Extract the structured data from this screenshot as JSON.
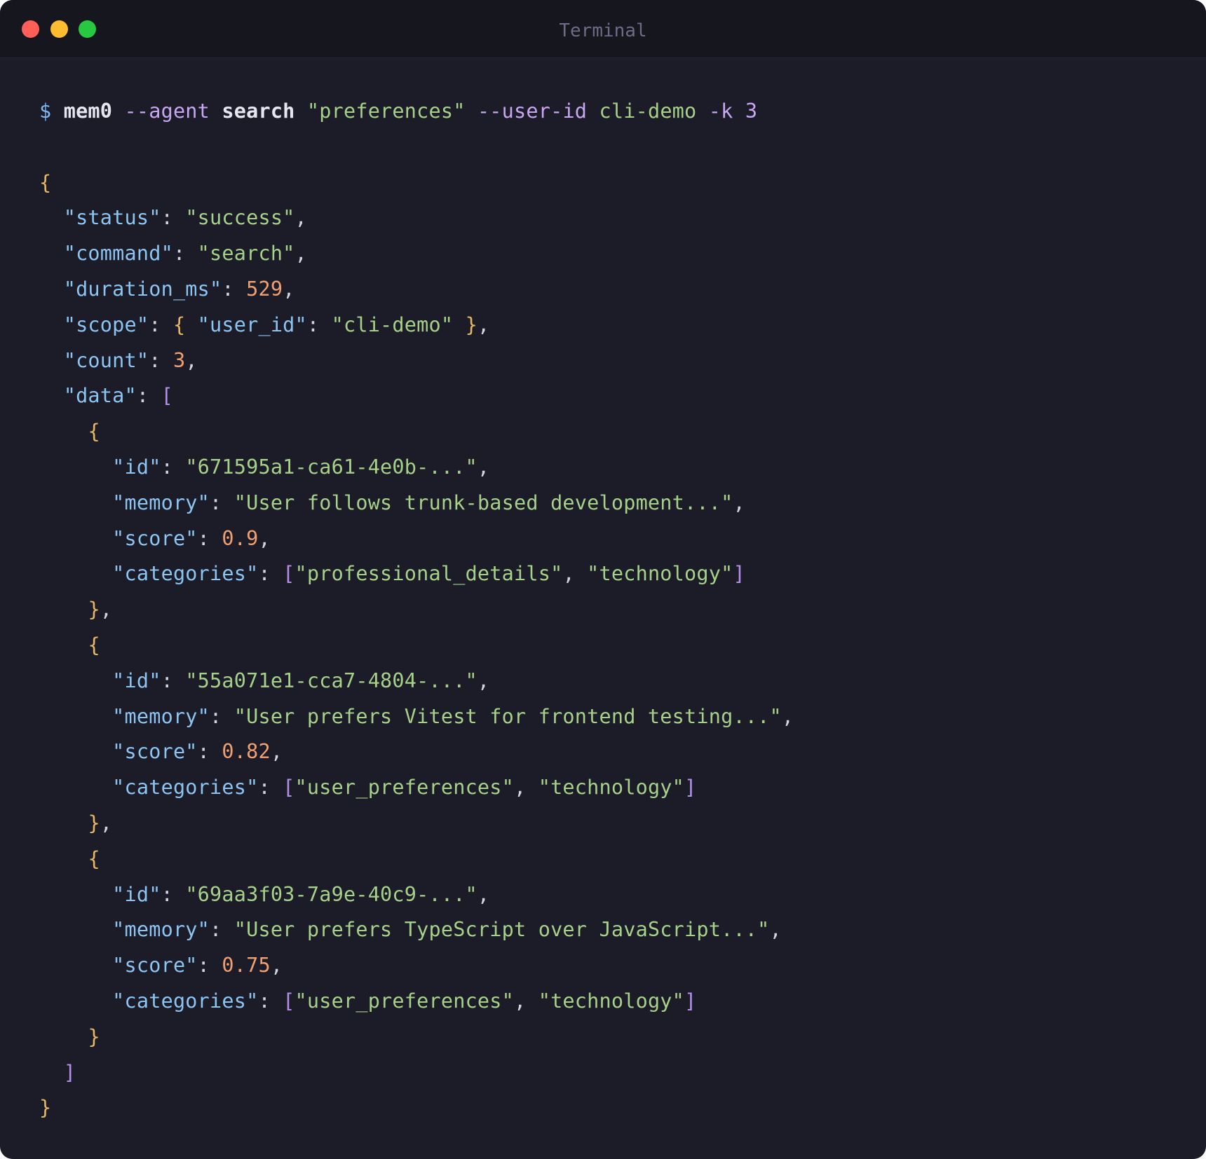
{
  "window": {
    "title": "Terminal"
  },
  "prompt": {
    "symbol": "$",
    "program": "mem0",
    "flag_agent": "--agent",
    "subcommand": "search",
    "query": "\"preferences\"",
    "flag_user": "--user-id",
    "user_value": "cli-demo",
    "flag_k": "-k",
    "k_value": "3"
  },
  "output": {
    "status_key": "\"status\"",
    "status_value": "\"success\"",
    "command_key": "\"command\"",
    "command_value": "\"search\"",
    "duration_key": "\"duration_ms\"",
    "duration_value": "529",
    "scope_key": "\"scope\"",
    "scope_user_key": "\"user_id\"",
    "scope_user_value": "\"cli-demo\"",
    "count_key": "\"count\"",
    "count_value": "3",
    "data_key": "\"data\"",
    "id_key": "\"id\"",
    "memory_key": "\"memory\"",
    "score_key": "\"score\"",
    "categories_key": "\"categories\"",
    "results": [
      {
        "id": "\"671595a1-ca61-4e0b-...\"",
        "memory": "\"User follows trunk-based development...\"",
        "score": "0.9",
        "cat1": "\"professional_details\"",
        "cat2": "\"technology\""
      },
      {
        "id": "\"55a071e1-cca7-4804-...\"",
        "memory": "\"User prefers Vitest for frontend testing...\"",
        "score": "0.82",
        "cat1": "\"user_preferences\"",
        "cat2": "\"technology\""
      },
      {
        "id": "\"69aa3f03-7a9e-40c9-...\"",
        "memory": "\"User prefers TypeScript over JavaScript...\"",
        "score": "0.75",
        "cat1": "\"user_preferences\"",
        "cat2": "\"technology\""
      }
    ]
  }
}
